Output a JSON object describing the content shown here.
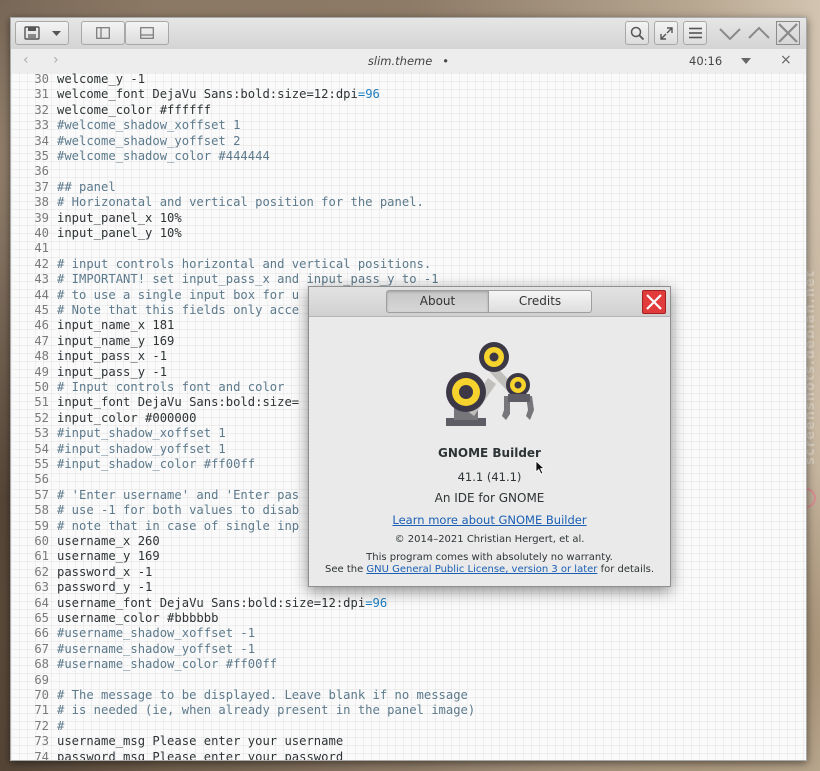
{
  "watermark": "screenshots.debian.net",
  "editor_window": {
    "tab": {
      "title": "slim.theme",
      "modified_marker": "•",
      "cursor_position": "40:16"
    },
    "lines": [
      {
        "n": "30",
        "text": "welcome_y -1"
      },
      {
        "n": "31",
        "text": "welcome_font DejaVu Sans:bold:size=12:dpi",
        "eq": "=",
        "num": "96"
      },
      {
        "n": "32",
        "text": "welcome_color #ffffff"
      },
      {
        "n": "33",
        "text": "#welcome_shadow_xoffset 1",
        "comment": true
      },
      {
        "n": "34",
        "text": "#welcome_shadow_yoffset 2",
        "comment": true
      },
      {
        "n": "35",
        "text": "#welcome_shadow_color #444444",
        "comment": true
      },
      {
        "n": "36",
        "text": ""
      },
      {
        "n": "37",
        "text": "## panel",
        "comment": true
      },
      {
        "n": "38",
        "text": "# Horizonatal and vertical position for the panel.",
        "comment": true
      },
      {
        "n": "39",
        "text": "input_panel_x 10%"
      },
      {
        "n": "40",
        "text": "input_panel_y 10%"
      },
      {
        "n": "41",
        "text": ""
      },
      {
        "n": "42",
        "text": "# input controls horizontal and vertical positions.",
        "comment": true
      },
      {
        "n": "43",
        "text": "# IMPORTANT! set input_pass_x and input_pass_y to -1",
        "comment": true
      },
      {
        "n": "44",
        "text": "# to use a single input box for u",
        "comment": true
      },
      {
        "n": "45",
        "text": "# Note that this fields only acce",
        "comment": true
      },
      {
        "n": "46",
        "text": "input_name_x 181"
      },
      {
        "n": "47",
        "text": "input_name_y 169"
      },
      {
        "n": "48",
        "text": "input_pass_x -1"
      },
      {
        "n": "49",
        "text": "input_pass_y -1"
      },
      {
        "n": "50",
        "text": "# Input controls font and color",
        "comment": true
      },
      {
        "n": "51",
        "text": "input_font DejaVu Sans:bold:size="
      },
      {
        "n": "52",
        "text": "input_color #000000"
      },
      {
        "n": "53",
        "text": "#input_shadow_xoffset 1",
        "comment": true
      },
      {
        "n": "54",
        "text": "#input_shadow_yoffset 1",
        "comment": true
      },
      {
        "n": "55",
        "text": "#input_shadow_color #ff00ff",
        "comment": true
      },
      {
        "n": "56",
        "text": ""
      },
      {
        "n": "57",
        "text": "# 'Enter username' and 'Enter pas",
        "comment": true
      },
      {
        "n": "58",
        "text": "# use -1 for both values to disab",
        "comment": true
      },
      {
        "n": "59",
        "text": "# note that in case of single inp",
        "comment": true
      },
      {
        "n": "60",
        "text": "username_x 260"
      },
      {
        "n": "61",
        "text": "username_y 169"
      },
      {
        "n": "62",
        "text": "password_x -1"
      },
      {
        "n": "63",
        "text": "password_y -1"
      },
      {
        "n": "64",
        "text": "username_font DejaVu Sans:bold:size=12:dpi",
        "eq": "=",
        "num": "96"
      },
      {
        "n": "65",
        "text": "username_color #bbbbbb"
      },
      {
        "n": "66",
        "text": "#username_shadow_xoffset -1",
        "comment": true
      },
      {
        "n": "67",
        "text": "#username_shadow_yoffset -1",
        "comment": true
      },
      {
        "n": "68",
        "text": "#username_shadow_color #ff00ff",
        "comment": true
      },
      {
        "n": "69",
        "text": ""
      },
      {
        "n": "70",
        "text": "# The message to be displayed. Leave blank if no message",
        "comment": true
      },
      {
        "n": "71",
        "text": "# is needed (ie, when already present in the panel image)",
        "comment": true
      },
      {
        "n": "72",
        "text": "#",
        "comment": true
      },
      {
        "n": "73",
        "text": "username_msg Please enter your username"
      },
      {
        "n": "74",
        "text": "password_msg Please enter your password"
      }
    ]
  },
  "about_dialog": {
    "tabs": [
      {
        "label": "About",
        "active": true
      },
      {
        "label": "Credits",
        "active": false
      }
    ],
    "app_name": "GNOME Builder",
    "version": "41.1 (41.1)",
    "comments": "An IDE for GNOME",
    "website_label": "Learn more about GNOME Builder",
    "copyright": "© 2014–2021 Christian Hergert, et al.",
    "license_line1": "This program comes with absolutely no warranty.",
    "license_prefix": "See the ",
    "license_link": "GNU General Public License, version 3 or later",
    "license_suffix": " for details."
  },
  "colors": {
    "close_red": "#e23b3b",
    "link": "#1a5fb4",
    "number": "#1b7dc1"
  },
  "icons": [
    "save-icon",
    "chevron-down-icon",
    "sidebar-left-icon",
    "bottom-panel-icon",
    "search-icon",
    "fullscreen-icon",
    "menu-icon",
    "minimize-icon",
    "maximize-icon",
    "close-icon",
    "back-icon",
    "forward-icon",
    "gnome-builder-logo"
  ]
}
